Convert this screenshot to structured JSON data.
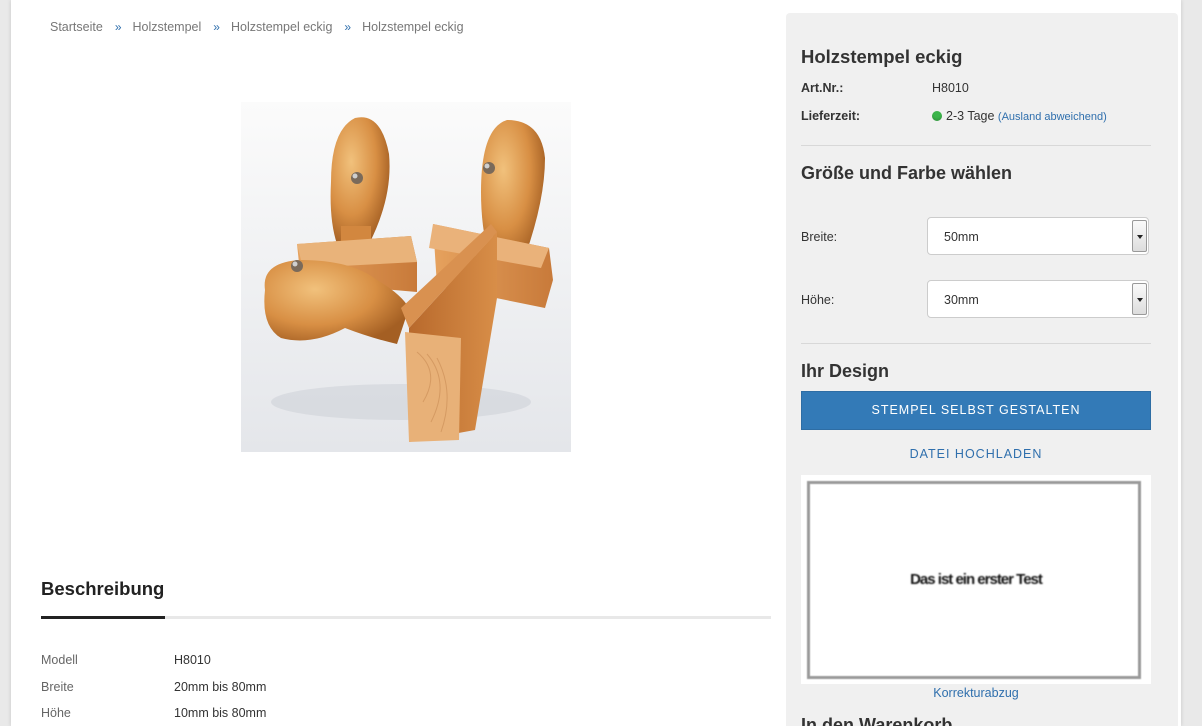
{
  "breadcrumb": {
    "items": [
      "Startseite",
      "Holzstempel",
      "Holzstempel eckig",
      "Holzstempel eckig"
    ],
    "separator": "»"
  },
  "description": {
    "title": "Beschreibung",
    "specs": [
      {
        "key": "Modell",
        "value": "H8010"
      },
      {
        "key": "Breite",
        "value": "20mm bis 80mm"
      },
      {
        "key": "Höhe",
        "value": "10mm bis 80mm"
      }
    ]
  },
  "sidebar": {
    "product_title": "Holzstempel eckig",
    "art_nr_label": "Art.Nr.:",
    "art_nr_value": "H8010",
    "delivery_label": "Lieferzeit:",
    "delivery_value": "2-3 Tage",
    "delivery_note": "(Ausland abweichend)",
    "size_color_heading": "Größe und Farbe wählen",
    "width_label": "Breite:",
    "width_value": "50mm",
    "height_label": "Höhe:",
    "height_value": "30mm",
    "design_heading": "Ihr Design",
    "design_button": "STEMPEL SELBST GESTALTEN",
    "upload_link": "DATEI HOCHLADEN",
    "preview_text": "Das ist ein erster Test",
    "proof_link": "Korrekturabzug",
    "cart_heading": "In den Warenkorb"
  },
  "colors": {
    "accent": "#337ab7",
    "link": "#2f6fad",
    "availability": "#3bb54a"
  }
}
